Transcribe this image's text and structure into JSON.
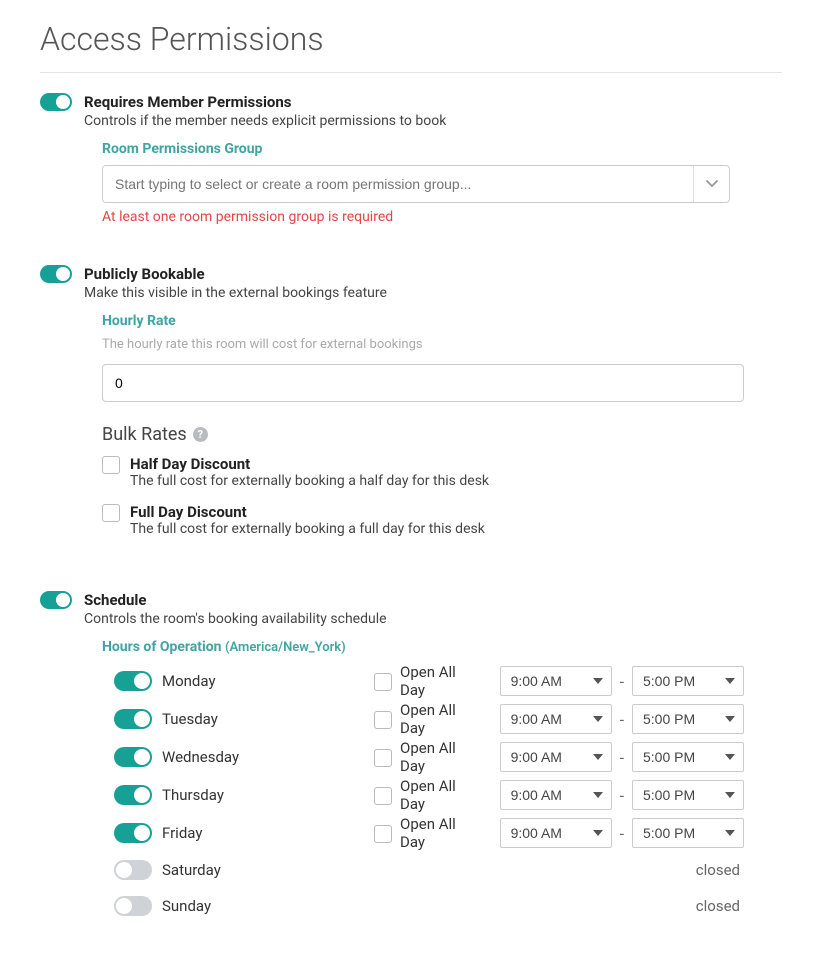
{
  "page": {
    "title": "Access Permissions"
  },
  "requires_permissions": {
    "enabled": true,
    "label": "Requires Member Permissions",
    "desc": "Controls if the member needs explicit permissions to book",
    "group_label": "Room Permissions Group",
    "group_placeholder": "Start typing to select or create a room permission group...",
    "error": "At least one room permission group is required"
  },
  "publicly_bookable": {
    "enabled": true,
    "label": "Publicly Bookable",
    "desc": "Make this visible in the external bookings feature",
    "hourly_rate_label": "Hourly Rate",
    "hourly_rate_hint": "The hourly rate this room will cost for external bookings",
    "hourly_rate_value": "0",
    "bulk_rates_label": "Bulk Rates",
    "half_day": {
      "label": "Half Day Discount",
      "desc": "The full cost for externally booking a half day for this desk",
      "checked": false
    },
    "full_day": {
      "label": "Full Day Discount",
      "desc": "The full cost for externally booking a full day for this desk",
      "checked": false
    }
  },
  "schedule": {
    "enabled": true,
    "label": "Schedule",
    "desc": "Controls the room's booking availability schedule",
    "hours_label": "Hours of Operation",
    "timezone": "(America/New_York)",
    "open_all_day_label": "Open All Day",
    "closed_label": "closed",
    "days": [
      {
        "name": "Monday",
        "enabled": true,
        "all_day": false,
        "open": "9:00 AM",
        "close": "5:00 PM"
      },
      {
        "name": "Tuesday",
        "enabled": true,
        "all_day": false,
        "open": "9:00 AM",
        "close": "5:00 PM"
      },
      {
        "name": "Wednesday",
        "enabled": true,
        "all_day": false,
        "open": "9:00 AM",
        "close": "5:00 PM"
      },
      {
        "name": "Thursday",
        "enabled": true,
        "all_day": false,
        "open": "9:00 AM",
        "close": "5:00 PM"
      },
      {
        "name": "Friday",
        "enabled": true,
        "all_day": false,
        "open": "9:00 AM",
        "close": "5:00 PM"
      },
      {
        "name": "Saturday",
        "enabled": false
      },
      {
        "name": "Sunday",
        "enabled": false
      }
    ]
  }
}
